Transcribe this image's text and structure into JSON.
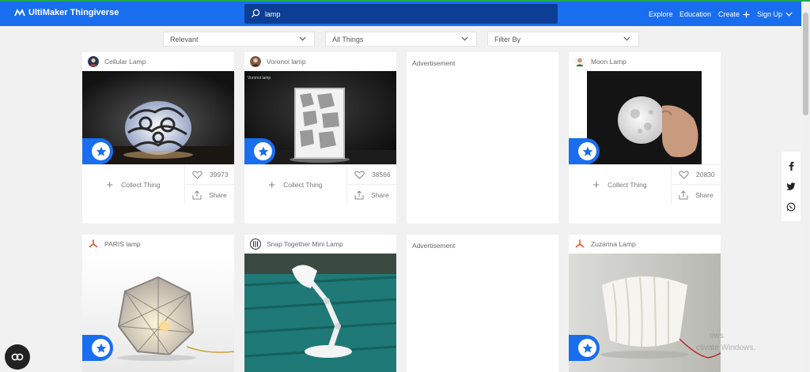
{
  "header": {
    "logo_text": "UltiMaker Thingiverse",
    "search_value": "lamp",
    "nav": {
      "explore": "Explore",
      "education": "Education",
      "create": "Create",
      "signup": "Sign Up"
    }
  },
  "filters": {
    "sort": "Relevant",
    "type": "All Things",
    "filter": "Filter By"
  },
  "cards": [
    {
      "title": "Cellular Lamp",
      "collect_label": "Collect Thing",
      "likes": "39973",
      "share_label": "Share"
    },
    {
      "title": "Voronoi lamp",
      "collect_label": "Collect Thing",
      "likes": "38566",
      "share_label": "Share"
    },
    {
      "title": "Moon Lamp",
      "collect_label": "Collect Thing",
      "likes": "20830",
      "share_label": "Share"
    },
    {
      "title": "PARIS lamp"
    },
    {
      "title": "Snap Together Mini Lamp"
    },
    {
      "title": "Zuzanna Lamp"
    }
  ],
  "ads": {
    "label": "Advertisement"
  },
  "social": [
    "facebook-icon",
    "twitter-icon",
    "whatsapp-icon"
  ],
  "watermark": {
    "line1": "ows",
    "line2": "ctivate Windows."
  },
  "colors": {
    "brand": "#196ef0",
    "search_bg": "#0d3e95",
    "top_strip": "#22a94c"
  }
}
